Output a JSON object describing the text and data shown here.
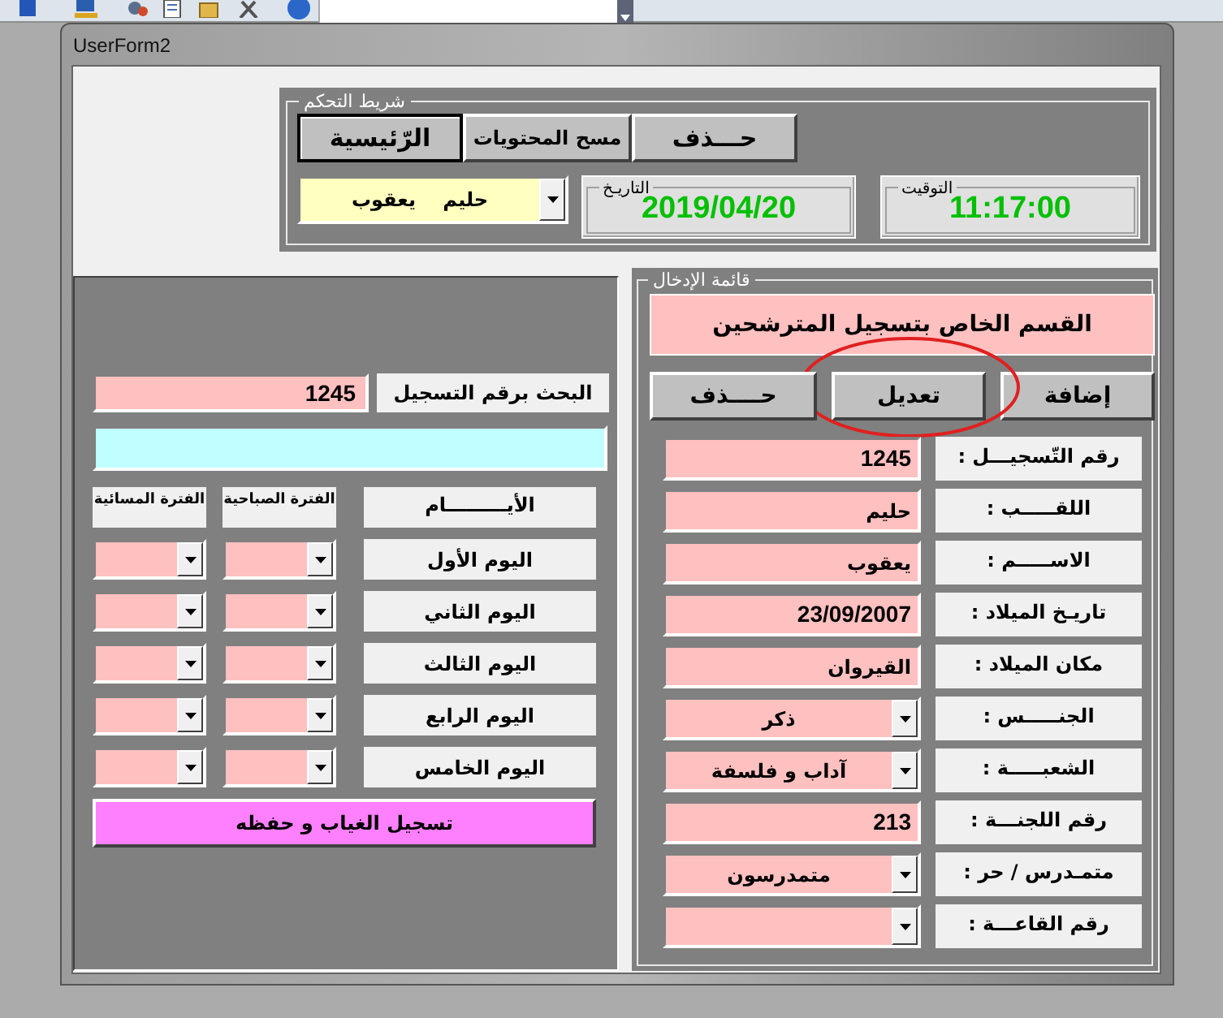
{
  "window": {
    "title": "UserForm2"
  },
  "control_bar": {
    "title": "شريط التحكم",
    "buttons": [
      {
        "label": "حـــذف",
        "default": false
      },
      {
        "label": "مسح المحتويات",
        "default": false
      },
      {
        "label": "الرّئيسية",
        "default": true
      }
    ],
    "name_combo": {
      "value": "حليم    يعقوب"
    },
    "date": {
      "caption": "التاريـخ",
      "value": "2019/04/20"
    },
    "time": {
      "caption": "التوقيت",
      "value": "11:17:00"
    }
  },
  "attendance": {
    "search_label": "البحث برقم التسجيل",
    "search_value": "1245",
    "columns": [
      "الأيـــــــــام",
      "الفترة الصباحية",
      "الفترة المسائية"
    ],
    "days": [
      {
        "label": "اليوم الأول"
      },
      {
        "label": "اليوم الثاني"
      },
      {
        "label": "اليوم الثالث"
      },
      {
        "label": "اليوم الرابع"
      },
      {
        "label": "اليوم الخامس"
      }
    ],
    "save_button": "تسجيل الغياب و حفظه"
  },
  "entry": {
    "title": "قائمة الإدخال",
    "heading": "القسم الخاص بتسجيل المترشحين",
    "buttons": [
      {
        "label": "إضافة",
        "highlighted": false
      },
      {
        "label": "تعديل",
        "highlighted": true
      },
      {
        "label": "حــــذف",
        "highlighted": false
      }
    ],
    "fields": [
      {
        "label": "رقم التّسجيـــل :",
        "value": "1245",
        "kind": "number"
      },
      {
        "label": "اللقـــــب :",
        "value": "حليم",
        "kind": "text"
      },
      {
        "label": "الاســـــم :",
        "value": "يعقوب",
        "kind": "text"
      },
      {
        "label": "تاريـخ الميلاد :",
        "value": "23/09/2007",
        "kind": "number"
      },
      {
        "label": "مكان الميلاد :",
        "value": "القيروان",
        "kind": "text"
      },
      {
        "label": "الجنـــــس :",
        "value": "ذكر",
        "kind": "combo"
      },
      {
        "label": "الشعبـــــة :",
        "value": "آداب و فلسفة",
        "kind": "combo"
      },
      {
        "label": "رقم اللجنـــة :",
        "value": "213",
        "kind": "number"
      },
      {
        "label": "متمـدرس / حر :",
        "value": "متمدرسون",
        "kind": "combo"
      },
      {
        "label": "رقم القاعـــة :",
        "kind": "combo"
      }
    ]
  }
}
